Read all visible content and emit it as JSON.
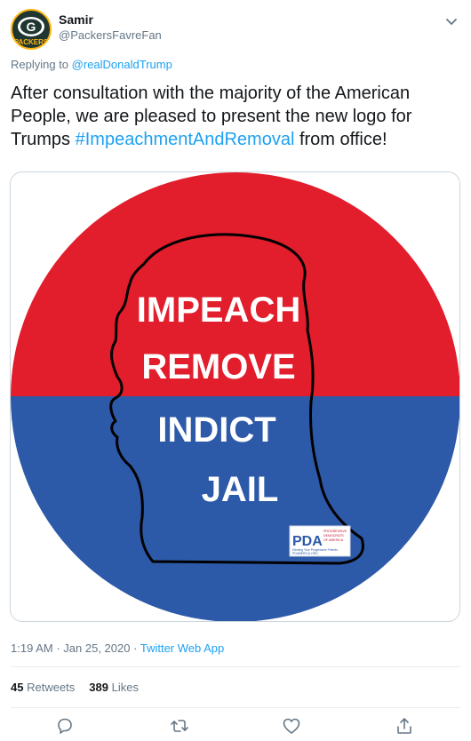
{
  "user": {
    "display_name": "Samir",
    "handle": "@PackersFavreFan",
    "avatar_letter": "G",
    "avatar_text": "PACKERS",
    "colors": {
      "green": "#203731",
      "gold": "#ffb612"
    }
  },
  "reply": {
    "prefix": "Replying to",
    "mention": "@realDonaldTrump"
  },
  "tweet": {
    "text_before": "After consultation with the majority of the American People, we are pleased to present the new logo for Trumps ",
    "hashtag": "#ImpeachmentAndRemoval",
    "text_after": " from office!"
  },
  "media": {
    "lines": [
      "IMPEACH",
      "REMOVE",
      "INDICT",
      "JAIL"
    ],
    "badge": {
      "logo": "PDA",
      "text_lines": [
        "PROGRESSIVE",
        "DEMOCRATS",
        "OF AMERICA",
        "Electing Your Progressive Friends",
        "PDAMERICA.ORG"
      ]
    },
    "colors": {
      "red": "#e21d2c",
      "blue": "#2c59a8",
      "text": "#ffffff",
      "outline": "#000000"
    }
  },
  "meta": {
    "time": "1:19 AM",
    "separator": "·",
    "date": "Jan 25, 2020",
    "source": "Twitter Web App"
  },
  "stats": {
    "retweets_count": "45",
    "retweets_label": "Retweets",
    "likes_count": "389",
    "likes_label": "Likes"
  },
  "actions": [
    "reply-icon",
    "retweet-icon",
    "like-icon",
    "share-icon"
  ],
  "colors": {
    "link": "#1da1f2",
    "secondary": "#657786",
    "icon": "#657786"
  }
}
